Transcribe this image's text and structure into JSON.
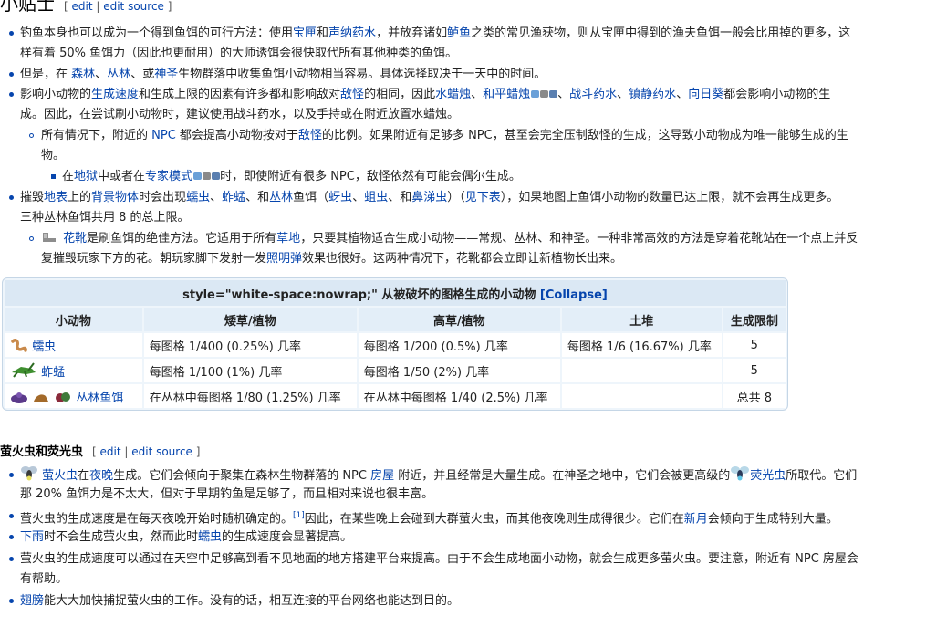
{
  "tips": {
    "heading": "小贴士",
    "edit": "edit",
    "edit_source": "edit source",
    "b1": {
      "t1": "钓鱼本身也可以成为一个得到鱼饵的可行方法：使用",
      "l1": "宝匣",
      "t2": "和",
      "l2": "声纳药水",
      "t3": "，并放弃诸如",
      "l3": "鲈鱼",
      "t4": "之类的常见渔获物，则从宝匣中得到的渔夫鱼饵一般会比用掉的更多，这",
      "t5": "样有着 50% 鱼饵力（因此也更耐用）的大师诱饵会很快取代所有其他种类的鱼饵。"
    },
    "b2": {
      "t1": "但是，在 ",
      "l1": "森林",
      "t2": "、",
      "l2": "丛林",
      "t3": "、或",
      "l3": "神圣",
      "t4": "生物群落中收集鱼饵小动物相当容易。具体选择取决于一天中的时间。"
    },
    "b3": {
      "t1": "影响小动物的",
      "l1": "生成速度",
      "t2": "和生成上限的因素有许多都和影响敌对",
      "l2": "敌怪",
      "t3": "的相同，因此",
      "l3": "水蜡烛",
      "t4": "、",
      "l4": "和平蜡烛",
      "t5": "、",
      "l5": "战斗药水",
      "t6": "、",
      "l6": "镇静药水",
      "t7": "、",
      "l7": "向日葵",
      "t8": "都会影响小动物的生",
      "t9": "成。因此，在尝试刷小动物时，建议使用战斗药水，以及手持或在附近放置水蜡烛。"
    },
    "b3a": {
      "t1": "所有情况下，附近的 ",
      "l1": "NPC",
      "t2": " 都会提高小动物按对于",
      "l2": "敌怪",
      "t3": "的比例。如果附近有足够多 NPC，甚至会完全压制敌怪的生成，这导致小动物成为唯一能够生成的生",
      "t4": "物。"
    },
    "b3b": {
      "t1": "在",
      "l1": "地狱",
      "t2": "中或者在",
      "l2": "专家模式",
      "t3": "时，即使附近有很多 NPC，敌怪依然有可能会偶尔生成。"
    },
    "b4": {
      "t1": "摧毁",
      "l1": "地表",
      "t2": "上的",
      "l2": "背景物体",
      "t3": "时会出现",
      "l3": "蠕虫",
      "t4": "、",
      "l4": "蚱蜢",
      "t5": "、和",
      "l5": "丛林",
      "t6": "鱼饵（",
      "l6": "蚜虫",
      "t7": "、",
      "l7": "蛆虫",
      "t8": "、和",
      "l8": "鼻涕虫",
      "t9": "）（",
      "l9": "见下表",
      "t10": "），如果地图上鱼饵小动物的数量已达上限，就不会再生成更多。",
      "t11": "三种丛林鱼饵共用 8 的总上限。"
    },
    "b4a": {
      "l1": "花靴",
      "t1": "是刷鱼饵的绝佳方法。它适用于所有",
      "l2": "草地",
      "t2": "，只要其植物适合生成小动物——常规、丛林、和神圣。一种非常高效的方法是穿着花靴站在一个点上并反",
      "t3": "复摧毁玩家下方的花。朝玩家脚下发射一发",
      "l3": "照明弹",
      "t4": "效果也很好。这两种情况下，花靴都会立即让新植物长出来。"
    }
  },
  "table": {
    "caption": "style=\"white-space:nowrap;\" 从被破坏的图格生成的小动物",
    "collapse": "[Collapse]",
    "headers": [
      "小动物",
      "矮草/植物",
      "高草/植物",
      "土堆",
      "生成限制"
    ],
    "rows": [
      {
        "name": "蠕虫",
        "short": "每图格 1/400 (0.25%) 几率",
        "tall": "每图格 1/200 (0.5%) 几率",
        "dirt": "每图格 1/6 (16.67%) 几率",
        "limit": "5"
      },
      {
        "name": "蚱蜢",
        "short": "每图格 1/100 (1%) 几率",
        "tall": "每图格 1/50 (2%) 几率",
        "dirt": "",
        "limit": "5"
      },
      {
        "name": "丛林鱼饵",
        "short": "在丛林中每图格 1/80 (1.25%) 几率",
        "tall": "在丛林中每图格 1/40 (2.5%) 几率",
        "dirt": "",
        "limit": "总共 8"
      }
    ]
  },
  "fireflies": {
    "heading": "萤火虫和荧光虫",
    "edit": "edit",
    "edit_source": "edit source",
    "f1": {
      "l1": "萤火虫",
      "t1": "在",
      "l2": "夜晚",
      "t2": "生成。它们会倾向于聚集在森林生物群落的 NPC ",
      "l3": "房屋",
      "t3": " 附近，并且经常是大量生成。在神圣之地中，它们会被更高级的",
      "l4": "荧光虫",
      "t4": "所取代。它们",
      "t5": "那 20% 鱼饵力是不太大，但对于早期钓鱼是足够了，而且相对来说也很丰富。"
    },
    "f2": {
      "t1": "萤火虫的生成速度是在每天夜晚开始时随机确定的。",
      "ref": "[1]",
      "t2": "因此，在某些晚上会碰到大群萤火虫，而其他夜晚则生成得很少。它们在",
      "l1": "新月",
      "t3": "会倾向于生成特别大量。"
    },
    "f3": {
      "l1": "下雨",
      "t1": "时不会生成萤火虫，然而此时",
      "l2": "蠕虫",
      "t2": "的生成速度会显著提高。"
    },
    "f4": {
      "t1": "萤火虫的生成速度可以通过在天空中足够高到看不见地面的地方搭建平台来提高。由于不会生成地面小动物，就会生成更多萤火虫。要注意，附近有 NPC 房屋会",
      "t2": "有帮助。"
    },
    "f5": {
      "l1": "翅膀",
      "t1": "能大大加快捕捉萤火虫的工作。没有的话，相互连接的平台网络也能达到目的。"
    }
  }
}
